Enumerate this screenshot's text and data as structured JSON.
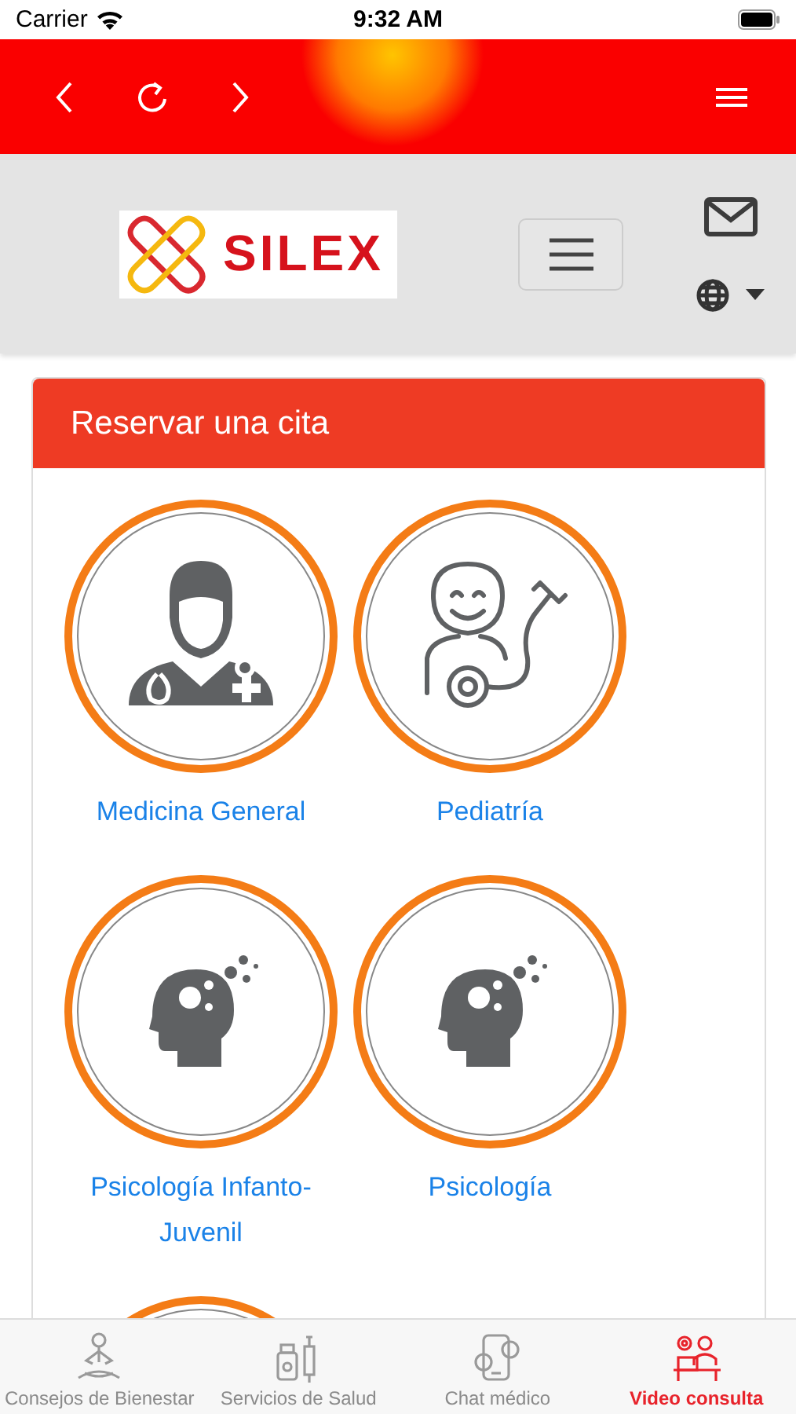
{
  "status_bar": {
    "carrier": "Carrier",
    "time": "9:32 AM"
  },
  "brand": {
    "logo_text": "SILEX"
  },
  "card": {
    "title": "Reservar una cita",
    "services": [
      {
        "kind": "doctor",
        "label": "Medicina General"
      },
      {
        "kind": "child",
        "label": "Pediatría"
      },
      {
        "kind": "mind",
        "label": "Psicología Infanto-Juvenil"
      },
      {
        "kind": "mind",
        "label": "Psicología"
      },
      {
        "kind": "partial"
      }
    ]
  },
  "tab_bar": [
    {
      "kind": "wellness",
      "label": "Consejos de Bienestar",
      "selected": false
    },
    {
      "kind": "health",
      "label": "Servicios de Salud",
      "selected": false
    },
    {
      "kind": "chat",
      "label": "Chat médico",
      "selected": false
    },
    {
      "kind": "video",
      "label": "Video consulta",
      "selected": true
    }
  ]
}
